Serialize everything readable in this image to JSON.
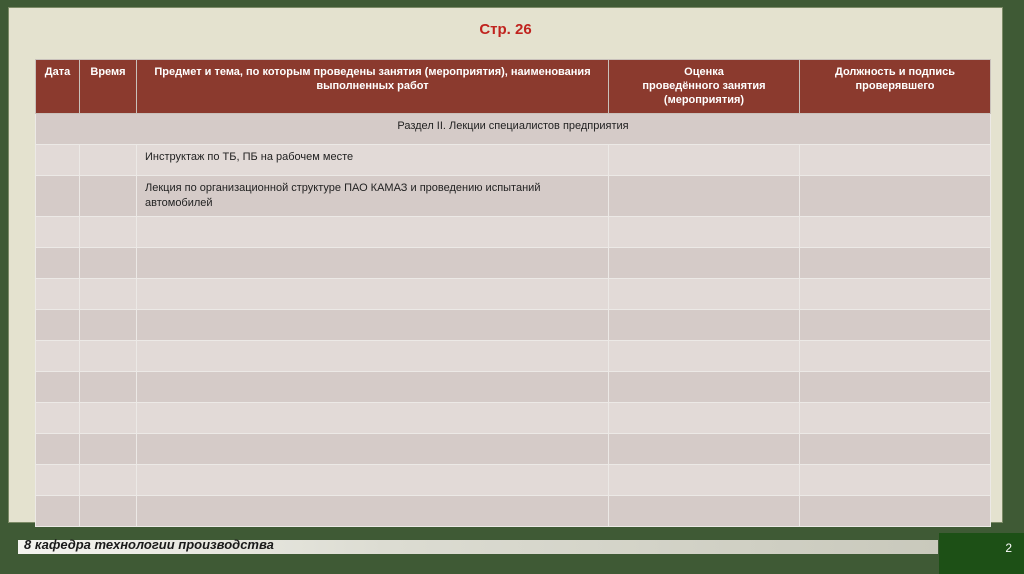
{
  "page_title": "Стр. 26",
  "table": {
    "headers": [
      "Дата",
      "Время",
      "Предмет и тема, по которым проведены занятия (мероприятия), наименования выполненных работ",
      "Оценка\nпроведённого занятия\n(мероприятия)",
      "Должность и подпись проверявшего"
    ],
    "section_title": "Раздел II. Лекции специалистов предприятия",
    "rows": [
      [
        "",
        "",
        "Инструктаж по ТБ, ПБ на рабочем месте",
        "",
        ""
      ],
      [
        "",
        "",
        "Лекция по организационной структуре ПАО КАМАЗ и проведению испытаний автомобилей",
        "",
        ""
      ],
      [
        "",
        "",
        "",
        "",
        ""
      ],
      [
        "",
        "",
        "",
        "",
        ""
      ],
      [
        "",
        "",
        "",
        "",
        ""
      ],
      [
        "",
        "",
        "",
        "",
        ""
      ],
      [
        "",
        "",
        "",
        "",
        ""
      ],
      [
        "",
        "",
        "",
        "",
        ""
      ],
      [
        "",
        "",
        "",
        "",
        ""
      ],
      [
        "",
        "",
        "",
        "",
        ""
      ],
      [
        "",
        "",
        "",
        "",
        ""
      ],
      [
        "",
        "",
        "",
        "",
        ""
      ]
    ]
  },
  "footer": {
    "text": "8 кафедра технологии производства",
    "page_number": "2"
  }
}
